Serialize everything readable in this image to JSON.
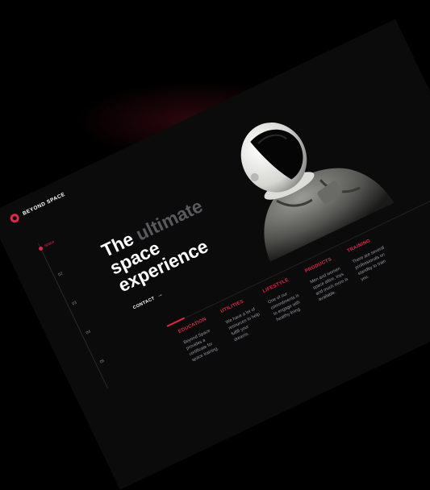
{
  "brand": {
    "name": "BEYOND SPACE",
    "accent": "#e4244a"
  },
  "nav": {
    "items": [
      {
        "label": "space"
      },
      {
        "label": "02"
      },
      {
        "label": "03"
      },
      {
        "label": "04"
      },
      {
        "label": "05"
      }
    ]
  },
  "hero": {
    "title_word_1": "The",
    "title_word_2": "ultimate",
    "title_line_2": "space",
    "title_line_3": "experience",
    "contact_label": "CONTACT",
    "contact_icon": "arrow-right-icon"
  },
  "features": [
    {
      "title": "EDUCATION",
      "text": "Beyond Space provides a certificate for space training."
    },
    {
      "title": "UTILITIES",
      "text": "We have a lot of resources to help fulfill your dreams."
    },
    {
      "title": "LIFESTYLE",
      "text": "One of our commitments is to engage with healthy living."
    },
    {
      "title": "PRODUCTS",
      "text": "Men and women space attire, toys and much more is available."
    },
    {
      "title": "TRAINING",
      "text": "There are several professionals on standby to train you."
    }
  ]
}
